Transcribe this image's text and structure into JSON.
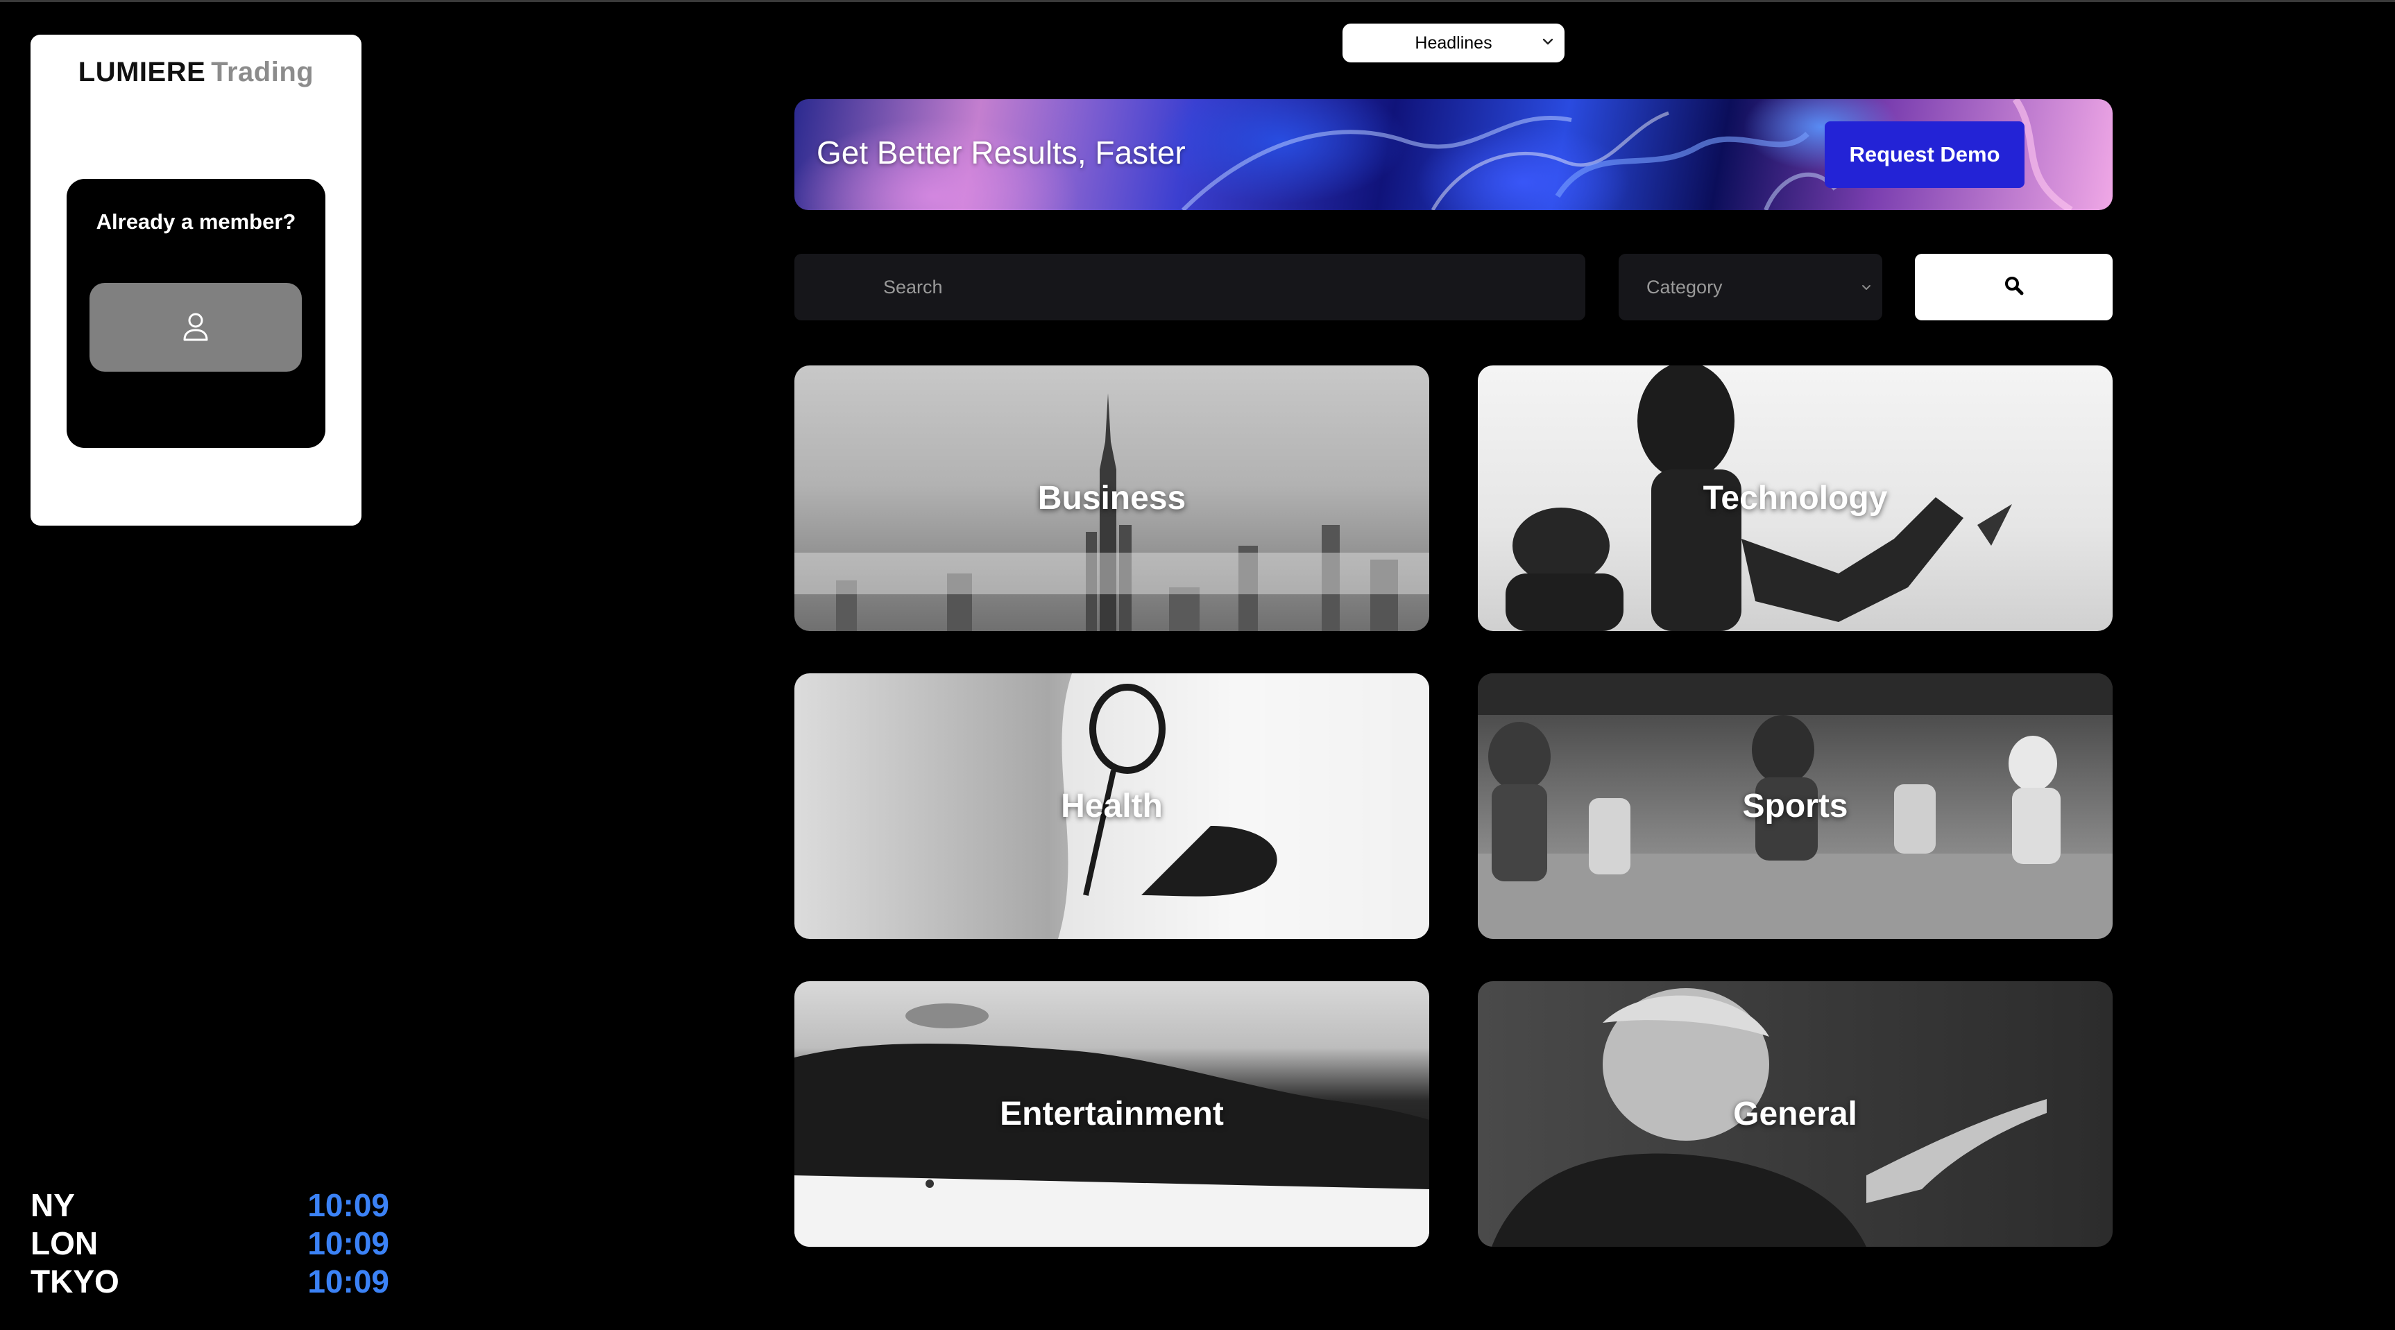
{
  "brand": {
    "name": "LUMIERE",
    "accent": "Trading"
  },
  "member": {
    "title": "Already a member?",
    "login_icon": "user-icon"
  },
  "clocks": [
    {
      "city": "NY",
      "time": "10:09"
    },
    {
      "city": "LON",
      "time": "10:09"
    },
    {
      "city": "TKYO",
      "time": "10:09"
    }
  ],
  "header": {
    "feed_select": "Headlines"
  },
  "banner": {
    "text": "Get Better Results, Faster",
    "cta": "Request Demo"
  },
  "search": {
    "placeholder": "Search",
    "category_placeholder": "Category",
    "button_icon": "search-icon"
  },
  "categories": [
    {
      "label": "Business"
    },
    {
      "label": "Technology"
    },
    {
      "label": "Health"
    },
    {
      "label": "Sports"
    },
    {
      "label": "Entertainment"
    },
    {
      "label": "General"
    }
  ],
  "colors": {
    "background": "#000000",
    "clock_time": "#3b82f6",
    "cta": "#2323d6",
    "field": "#16161a"
  }
}
